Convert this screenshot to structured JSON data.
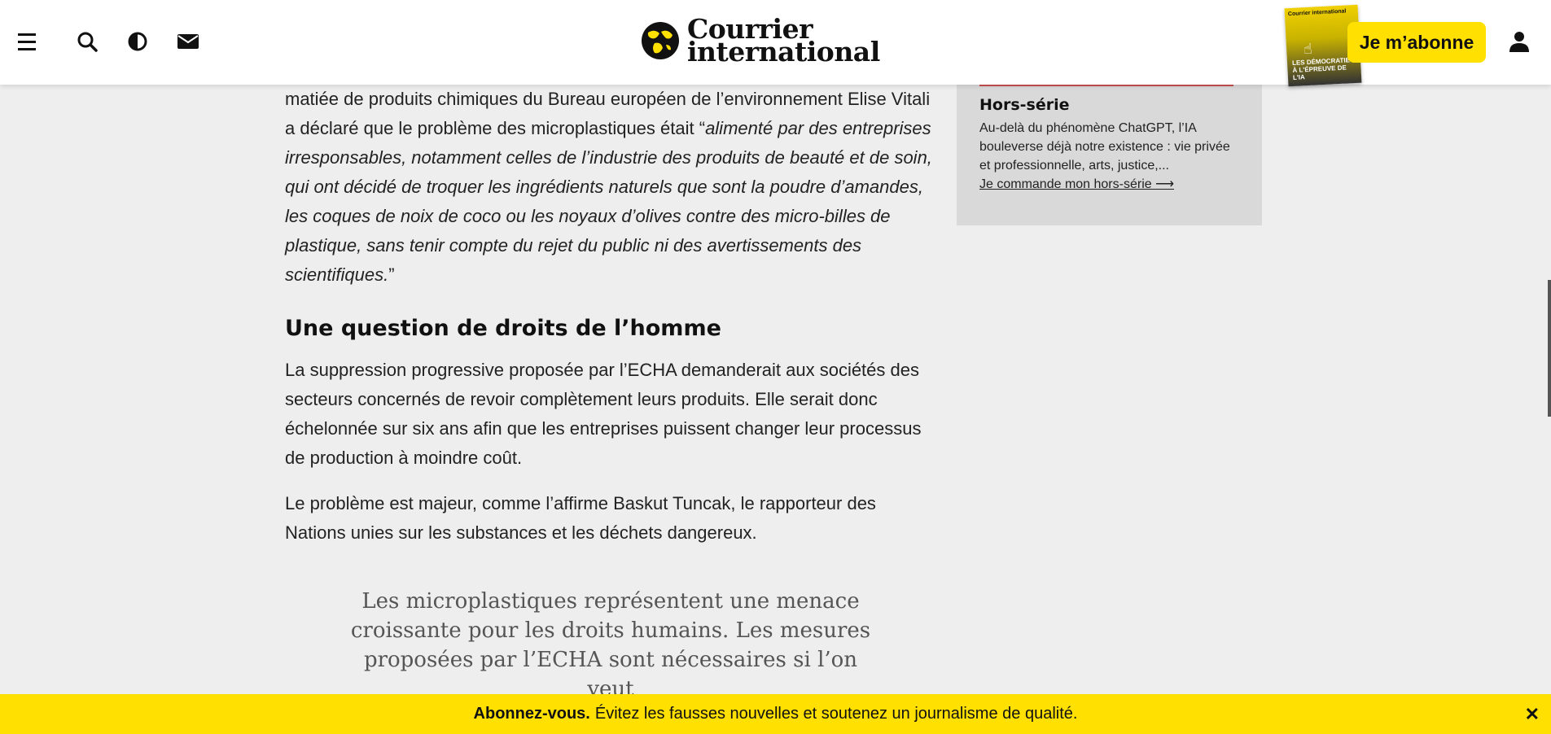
{
  "header": {
    "menu_icon": "hamburger-menu-icon",
    "search_icon": "search-icon",
    "contrast_icon": "contrast-icon",
    "mail_icon": "mail-icon",
    "logo_line1": "Courrier",
    "logo_line2": "international",
    "magazine_cover_top": "Courrier international",
    "magazine_cover_bottom": "LES DÉMOCRATIES À L'ÉPREUVE DE L'IA",
    "subscribe_label": "Je m’abonne",
    "user_icon": "user-icon",
    "accent_color": "#ffe000"
  },
  "article": {
    "para1_start": "matiée de produits chimiques du Bureau européen de l’environnement Elise Vitali a déclaré que le problème des microplastiques était “",
    "para1_italic": "alimenté par des entreprises irresponsables, notamment celles de l’industrie des produits de beauté et de soin, qui ont décidé de troquer les ingrédients naturels que sont la poudre d’amandes, les coques de noix de coco ou les noyaux d’olives contre des micro-billes de plastique, sans tenir compte du rejet du public ni des avertissements des scientifiques.",
    "para1_end": "”",
    "heading": "Une question de droits de l’homme",
    "para2": "La suppression progressive proposée par l’ECHA demanderait aux sociétés des secteurs concernés de revoir complètement leurs produits. Elle serait donc échelonnée sur six ans afin que les entreprises puissent changer leur processus de production à moindre coût.",
    "para3": "Le problème est majeur, comme l’affirme Baskut Tuncak, le rapporteur des Nations unies sur les substances et les déchets dangereux.",
    "quote": "Les microplastiques représentent une menace croissante pour les droits humains. Les mesures proposées par l’ECHA sont nécessaires si l’on veut"
  },
  "sidebar": {
    "title": "Hors-série",
    "text": "Au-delà du phénomène ChatGPT, l’IA bouleverse déjà notre existence : vie privée et professionnelle, arts, justice,...",
    "link": "Je commande mon hors-série ⟶"
  },
  "banner": {
    "bold": "Abonnez-vous.",
    "text": "Évitez les fausses nouvelles et soutenez un journalisme de qualité.",
    "close": "✕"
  }
}
